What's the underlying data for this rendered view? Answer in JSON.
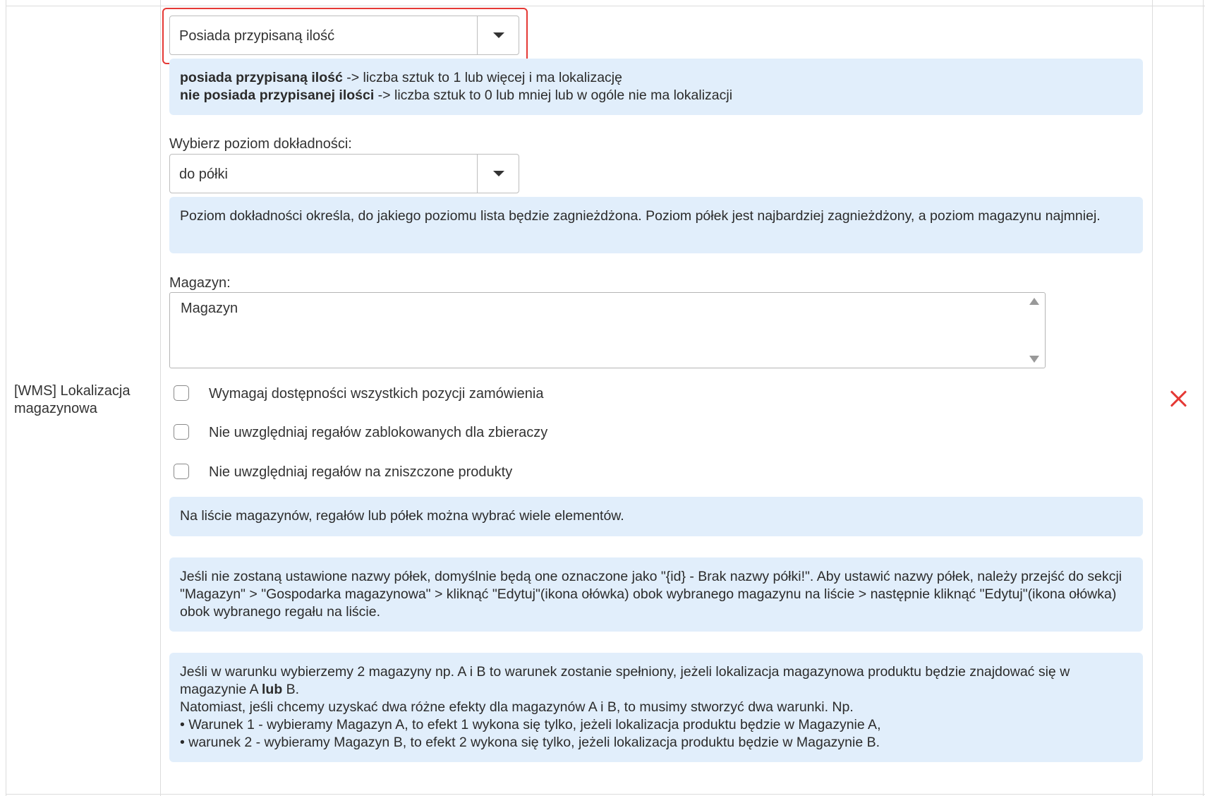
{
  "row": {
    "label": "[WMS] Lokalizacja magazynowa"
  },
  "quantity_select": {
    "value": "Posiada przypisaną ilość"
  },
  "quantity_info": {
    "line1_bold": "posiada przypisaną ilość",
    "line1_rest": " -> liczba sztuk to 1 lub więcej i ma lokalizację",
    "line2_bold": "nie posiada przypisanej ilości",
    "line2_rest": " -> liczba sztuk to 0 lub mniej lub w ogóle nie ma lokalizacji"
  },
  "precision": {
    "label": "Wybierz poziom dokładności:",
    "value": "do półki",
    "info": "Poziom dokładności określa, do jakiego poziomu lista będzie zagnieżdżona. Poziom półek jest najbardziej zagnieżdżony, a poziom magazynu najmniej."
  },
  "warehouse": {
    "label": "Magazyn:",
    "items": [
      "Magazyn"
    ]
  },
  "checkboxes": [
    {
      "label": "Wymagaj dostępności wszystkich pozycji zamówienia",
      "checked": false
    },
    {
      "label": "Nie uwzględniaj regałów zablokowanych dla zbieraczy",
      "checked": false
    },
    {
      "label": "Nie uwzględniaj regałów na zniszczone produkty",
      "checked": false
    }
  ],
  "info_multi": "Na liście magazynów, regałów lub półek można wybrać wiele elementów.",
  "info_shelf_names": "Jeśli nie zostaną ustawione nazwy półek, domyślnie będą one oznaczone jako \"{id} - Brak nazwy półki!\". Aby ustawić nazwy półek, należy przejść do sekcji \"Magazyn\" > \"Gospodarka magazynowa\" > kliknąć \"Edytuj\"(ikona ołówka) obok wybranego magazynu na liście > następnie kliknąć \"Edytuj\"(ikona ołówka) obok wybranego regału na liście.",
  "info_example": {
    "part1": "Jeśli w warunku wybierzemy 2 magazyny np. A i B to warunek zostanie spełniony, jeżeli lokalizacja magazynowa produktu będzie znajdować się w magazynie A ",
    "bold": "lub",
    "part2": " B.",
    "line2": "Natomiast, jeśli chcemy uzyskać dwa różne efekty dla magazynów A i B, to musimy stworzyć dwa warunki. Np.",
    "line3": "• Warunek 1 - wybieramy Magazyn A, to efekt 1 wykona się tylko, jeżeli lokalizacja produktu będzie w Magazynie A,",
    "line4": "• warunek 2 - wybieramy Magazyn B, to efekt 2 wykona się tylko, jeżeli lokalizacja produktu będzie w Magazynie B."
  },
  "colors": {
    "info_bg": "#e1eefb",
    "highlight": "#e53935",
    "delete": "#e53935",
    "border": "#dcdcdc"
  },
  "icons": [
    "chevron-down-icon",
    "close-icon",
    "scroll-up-arrow-icon",
    "scroll-down-arrow-icon"
  ]
}
